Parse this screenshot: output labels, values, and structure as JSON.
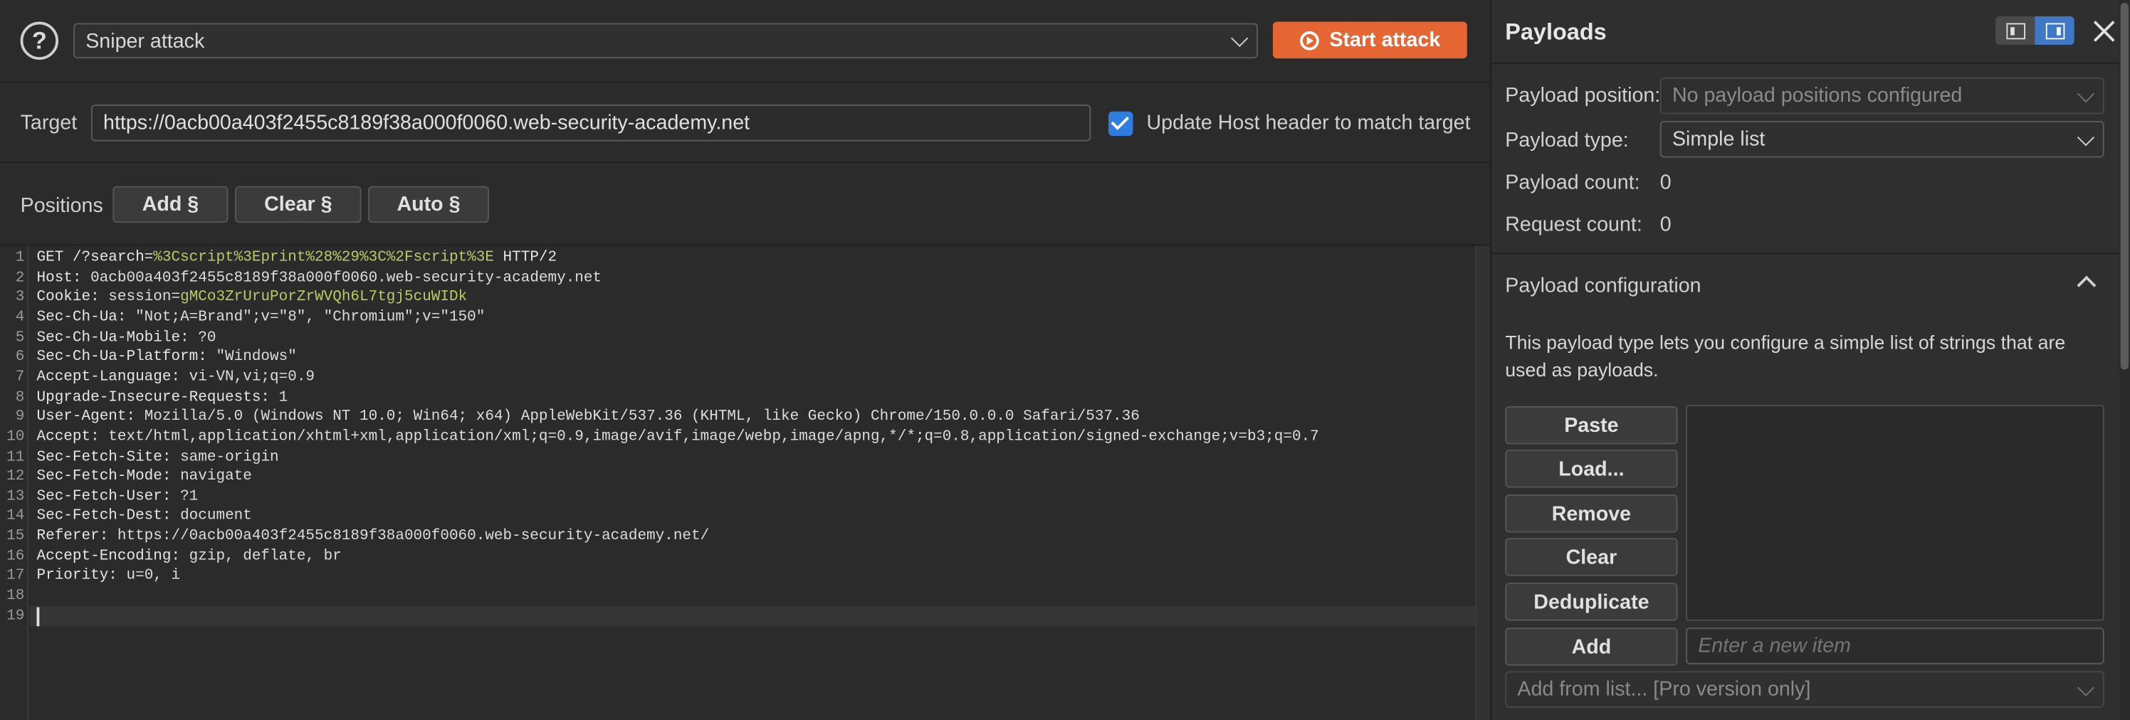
{
  "header": {
    "attack_type": "Sniper attack",
    "start_attack_label": "Start attack"
  },
  "target": {
    "label": "Target",
    "url": "https://0acb00a403f2455c8189f38a000f0060.web-security-academy.net",
    "update_host_label": "Update Host header to match target",
    "update_host_checked": true
  },
  "positions": {
    "label": "Positions",
    "add_label": "Add §",
    "clear_label": "Clear §",
    "auto_label": "Auto §"
  },
  "request": {
    "lines": [
      {
        "n": "1",
        "parts": [
          [
            "hdr",
            "GET /?search="
          ],
          [
            "hl",
            "%3Cscript%3Eprint%28%29%3C%2Fscript%3E"
          ],
          [
            "hdr",
            " HTTP/2"
          ]
        ]
      },
      {
        "n": "2",
        "parts": [
          [
            "hdr",
            "Host:"
          ],
          [
            "",
            " 0acb00a403f2455c8189f38a000f0060.web-security-academy.net"
          ]
        ]
      },
      {
        "n": "3",
        "parts": [
          [
            "hdr",
            "Cookie:"
          ],
          [
            "",
            " session="
          ],
          [
            "hl",
            "gMCo3ZrUruPorZrWVQh6L7tgj5cuWIDk"
          ]
        ]
      },
      {
        "n": "4",
        "parts": [
          [
            "hdr",
            "Sec-Ch-Ua:"
          ],
          [
            "",
            " \"Not;A=Brand\";v=\"8\", \"Chromium\";v=\"150\""
          ]
        ]
      },
      {
        "n": "5",
        "parts": [
          [
            "hdr",
            "Sec-Ch-Ua-Mobile:"
          ],
          [
            "",
            " ?0"
          ]
        ]
      },
      {
        "n": "6",
        "parts": [
          [
            "hdr",
            "Sec-Ch-Ua-Platform:"
          ],
          [
            "",
            " \"Windows\""
          ]
        ]
      },
      {
        "n": "7",
        "parts": [
          [
            "hdr",
            "Accept-Language:"
          ],
          [
            "",
            " vi-VN,vi;q=0.9"
          ]
        ]
      },
      {
        "n": "8",
        "parts": [
          [
            "hdr",
            "Upgrade-Insecure-Requests:"
          ],
          [
            "",
            " 1"
          ]
        ]
      },
      {
        "n": "9",
        "parts": [
          [
            "hdr",
            "User-Agent:"
          ],
          [
            "",
            " Mozilla/5.0 (Windows NT 10.0; Win64; x64) AppleWebKit/537.36 (KHTML, like Gecko) Chrome/150.0.0.0 Safari/537.36"
          ]
        ]
      },
      {
        "n": "10",
        "parts": [
          [
            "hdr",
            "Accept:"
          ],
          [
            "",
            " text/html,application/xhtml+xml,application/xml;q=0.9,image/avif,image/webp,image/apng,*/*;q=0.8,application/signed-exchange;v=b3;q=0.7"
          ]
        ]
      },
      {
        "n": "11",
        "parts": [
          [
            "hdr",
            "Sec-Fetch-Site:"
          ],
          [
            "",
            " same-origin"
          ]
        ]
      },
      {
        "n": "12",
        "parts": [
          [
            "hdr",
            "Sec-Fetch-Mode:"
          ],
          [
            "",
            " navigate"
          ]
        ]
      },
      {
        "n": "13",
        "parts": [
          [
            "hdr",
            "Sec-Fetch-User:"
          ],
          [
            "",
            " ?1"
          ]
        ]
      },
      {
        "n": "14",
        "parts": [
          [
            "hdr",
            "Sec-Fetch-Dest:"
          ],
          [
            "",
            " document"
          ]
        ]
      },
      {
        "n": "15",
        "parts": [
          [
            "hdr",
            "Referer:"
          ],
          [
            "",
            " https://0acb00a403f2455c8189f38a000f0060.web-security-academy.net/"
          ]
        ]
      },
      {
        "n": "16",
        "parts": [
          [
            "hdr",
            "Accept-Encoding:"
          ],
          [
            "",
            " gzip, deflate, br"
          ]
        ]
      },
      {
        "n": "17",
        "parts": [
          [
            "hdr",
            "Priority:"
          ],
          [
            "",
            " u=0, i"
          ]
        ]
      },
      {
        "n": "18",
        "parts": []
      },
      {
        "n": "19",
        "parts": []
      }
    ]
  },
  "payloads": {
    "title": "Payloads",
    "position_label": "Payload position:",
    "position_value": "No payload positions configured",
    "type_label": "Payload type:",
    "type_value": "Simple list",
    "count_label": "Payload count:",
    "count_value": "0",
    "request_count_label": "Request count:",
    "request_count_value": "0",
    "config_title": "Payload configuration",
    "config_desc": "This payload type lets you configure a simple list of strings that are used as payloads.",
    "buttons": {
      "paste": "Paste",
      "load": "Load...",
      "remove": "Remove",
      "clear": "Clear",
      "dedup": "Deduplicate",
      "add": "Add"
    },
    "new_item_placeholder": "Enter a new item",
    "add_from_list": "Add from list... [Pro version only]"
  }
}
